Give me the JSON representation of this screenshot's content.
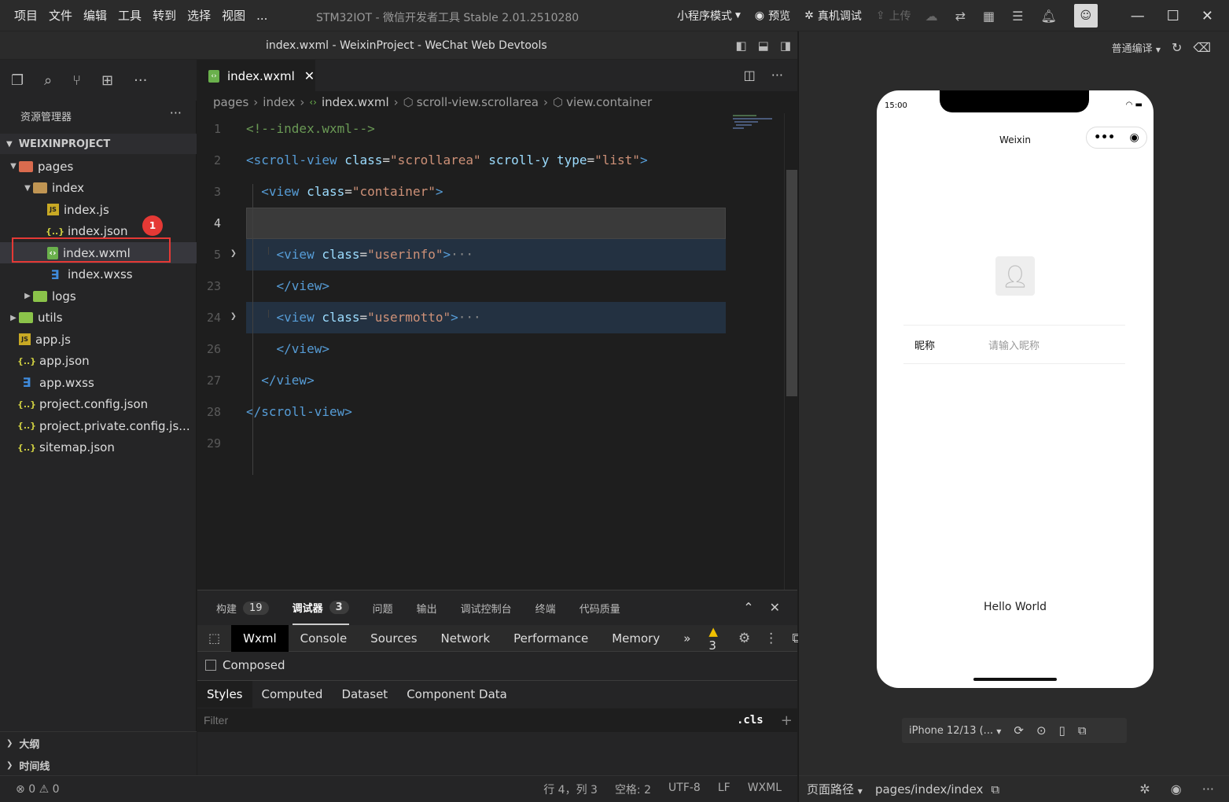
{
  "menu": {
    "items": [
      "项目",
      "文件",
      "编辑",
      "工具",
      "转到",
      "选择",
      "视图",
      "..."
    ]
  },
  "app_title": "STM32IOT - 微信开发者工具 Stable 2.01.2510280",
  "toolbar": {
    "mode": "小程序模式",
    "preview": "预览",
    "device_debug": "真机调试",
    "upload": "上传"
  },
  "window_title": "index.wxml - WeixinProject - WeChat Web Devtools",
  "explorer": {
    "header": "资源管理器",
    "project": "WEIXINPROJECT",
    "items": [
      {
        "label": "pages",
        "type": "folder-red",
        "level": 1,
        "open": true
      },
      {
        "label": "index",
        "type": "folder",
        "level": 2,
        "open": true
      },
      {
        "label": "index.js",
        "type": "js",
        "level": 3
      },
      {
        "label": "index.json",
        "type": "json",
        "level": 3
      },
      {
        "label": "index.wxml",
        "type": "wxml",
        "level": 3,
        "selected": true
      },
      {
        "label": "index.wxss",
        "type": "wxss",
        "level": 3
      },
      {
        "label": "logs",
        "type": "folder-green",
        "level": 2,
        "open": false
      },
      {
        "label": "utils",
        "type": "folder-green",
        "level": 1,
        "open": false
      },
      {
        "label": "app.js",
        "type": "js",
        "level": 1
      },
      {
        "label": "app.json",
        "type": "json",
        "level": 1
      },
      {
        "label": "app.wxss",
        "type": "wxss",
        "level": 1
      },
      {
        "label": "project.config.json",
        "type": "json",
        "level": 1
      },
      {
        "label": "project.private.config.js...",
        "type": "json",
        "level": 1
      },
      {
        "label": "sitemap.json",
        "type": "json",
        "level": 1
      }
    ],
    "badge": "1",
    "outline": "大纲",
    "timeline": "时间线"
  },
  "editor": {
    "tab": "index.wxml",
    "breadcrumb": [
      "pages",
      "index",
      "index.wxml",
      "scroll-view.scrollarea",
      "view.container"
    ],
    "lines": [
      {
        "n": "1",
        "tokens": [
          [
            "cm",
            "<!--index.wxml-->"
          ]
        ]
      },
      {
        "n": "2",
        "tokens": [
          [
            "tg",
            "<scroll-view "
          ],
          [
            "at",
            "class"
          ],
          [
            "tx",
            "="
          ],
          [
            "st",
            "\"scrollarea\""
          ],
          [
            "at",
            " scroll-y "
          ],
          [
            "at",
            "type"
          ],
          [
            "tx",
            "="
          ],
          [
            "st",
            "\"list\""
          ],
          [
            "tg",
            ">"
          ]
        ]
      },
      {
        "n": "3",
        "tokens": [
          [
            "tx",
            "  "
          ],
          [
            "tg",
            "<view "
          ],
          [
            "at",
            "class"
          ],
          [
            "tx",
            "="
          ],
          [
            "st",
            "\"container\""
          ],
          [
            "tg",
            ">"
          ]
        ]
      },
      {
        "n": "4",
        "tokens": []
      },
      {
        "n": "5",
        "tokens": [
          [
            "tx",
            "    "
          ],
          [
            "tg",
            "<view "
          ],
          [
            "at",
            "class"
          ],
          [
            "tx",
            "="
          ],
          [
            "st",
            "\"userinfo\""
          ],
          [
            "tg",
            ">"
          ],
          [
            "el",
            "···"
          ]
        ]
      },
      {
        "n": "23",
        "tokens": [
          [
            "tx",
            "    "
          ],
          [
            "tg",
            "</view>"
          ]
        ]
      },
      {
        "n": "24",
        "tokens": [
          [
            "tx",
            "    "
          ],
          [
            "tg",
            "<view "
          ],
          [
            "at",
            "class"
          ],
          [
            "tx",
            "="
          ],
          [
            "st",
            "\"usermotto\""
          ],
          [
            "tg",
            ">"
          ],
          [
            "el",
            "···"
          ]
        ]
      },
      {
        "n": "26",
        "tokens": [
          [
            "tx",
            "    "
          ],
          [
            "tg",
            "</view>"
          ]
        ]
      },
      {
        "n": "27",
        "tokens": [
          [
            "tx",
            "  "
          ],
          [
            "tg",
            "</view>"
          ]
        ]
      },
      {
        "n": "28",
        "tokens": [
          [
            "tg",
            "</scroll-view>"
          ]
        ]
      },
      {
        "n": "29",
        "tokens": []
      }
    ]
  },
  "panel": {
    "tabs": [
      {
        "label": "构建",
        "count": "19"
      },
      {
        "label": "调试器",
        "count": "3"
      },
      {
        "label": "问题"
      },
      {
        "label": "输出"
      },
      {
        "label": "调试控制台"
      },
      {
        "label": "终端"
      },
      {
        "label": "代码质量"
      }
    ],
    "devtools_tabs": [
      "Wxml",
      "Console",
      "Sources",
      "Network",
      "Performance",
      "Memory"
    ],
    "warn_count": "3",
    "composed": "Composed",
    "style_tabs": [
      "Styles",
      "Computed",
      "Dataset",
      "Component Data"
    ],
    "filter_placeholder": "Filter",
    "cls": ".cls"
  },
  "status": {
    "errors": "0",
    "warnings": "0",
    "position": "行 4，列 3",
    "spaces": "空格: 2",
    "encoding": "UTF-8",
    "eol": "LF",
    "lang": "WXML"
  },
  "simulator": {
    "compile_mode": "普通编译",
    "time": "15:00",
    "page_title": "Weixin",
    "nick_label": "昵称",
    "nick_placeholder": "请输入昵称",
    "hello": "Hello World",
    "device": "iPhone 12/13 (...",
    "path_label": "页面路径",
    "path": "pages/index/index"
  }
}
